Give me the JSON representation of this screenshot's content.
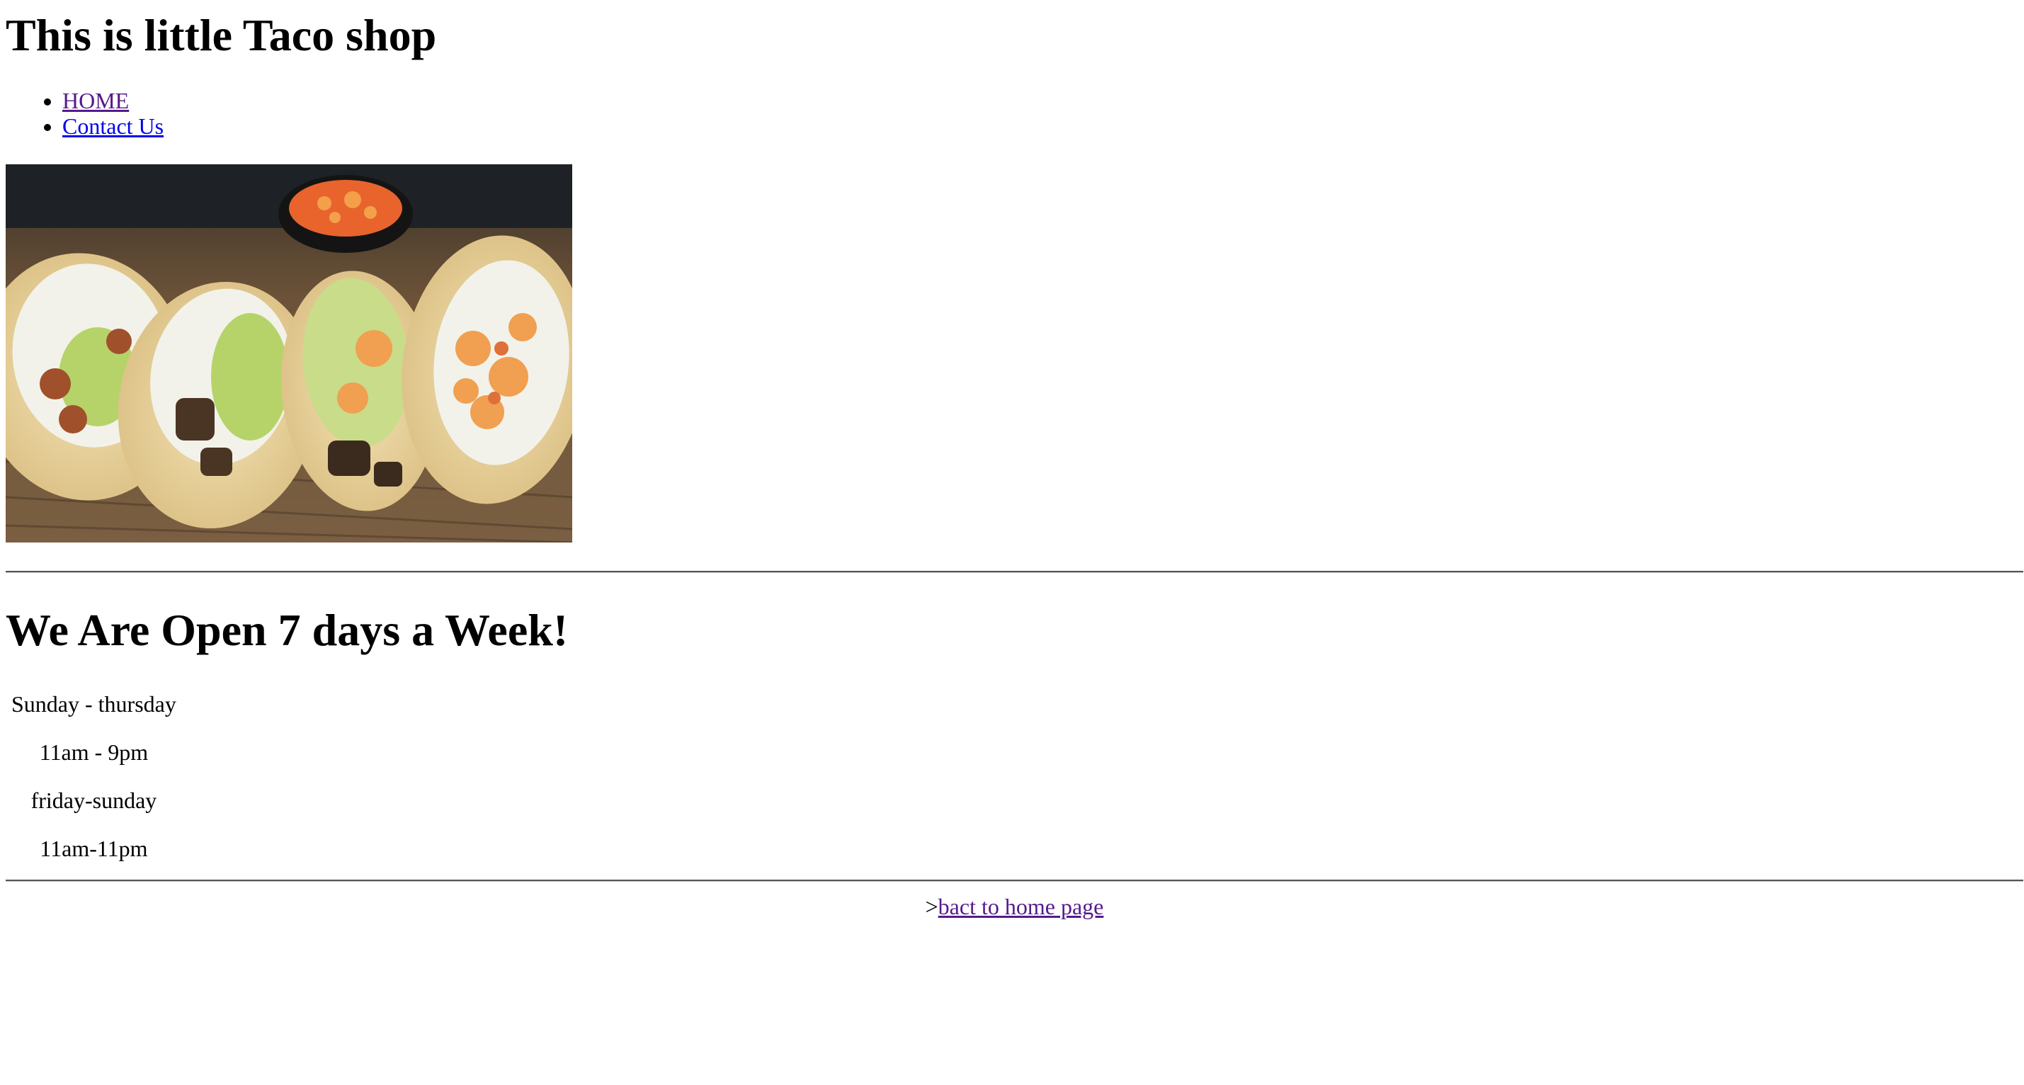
{
  "header": {
    "title": "This is little Taco shop"
  },
  "nav": {
    "items": [
      {
        "label": "HOME",
        "visited": true
      },
      {
        "label": "Contact Us",
        "visited": false
      }
    ]
  },
  "hero_image": {
    "icon": "tacos-photo",
    "description_colors": {
      "board": "#6b5238",
      "tortilla": "#e8d3a0",
      "lettuce": "#f2f2ea",
      "guacamole": "#b6d36a",
      "shrimp": "#f0a050",
      "salsa": "#e8642c"
    }
  },
  "hours": {
    "heading": "We Are Open 7 days a Week!",
    "rows": [
      {
        "cell": "Sunday - thursday"
      },
      {
        "cell": "11am - 9pm"
      },
      {
        "cell": "friday-sunday"
      },
      {
        "cell": "11am-11pm"
      }
    ]
  },
  "footer": {
    "prefix": ">",
    "link_label": "bact to home page"
  },
  "colors": {
    "link_visited": "#551a8b",
    "link_unvisited": "#0000ee",
    "text": "#000000",
    "background": "#ffffff"
  }
}
